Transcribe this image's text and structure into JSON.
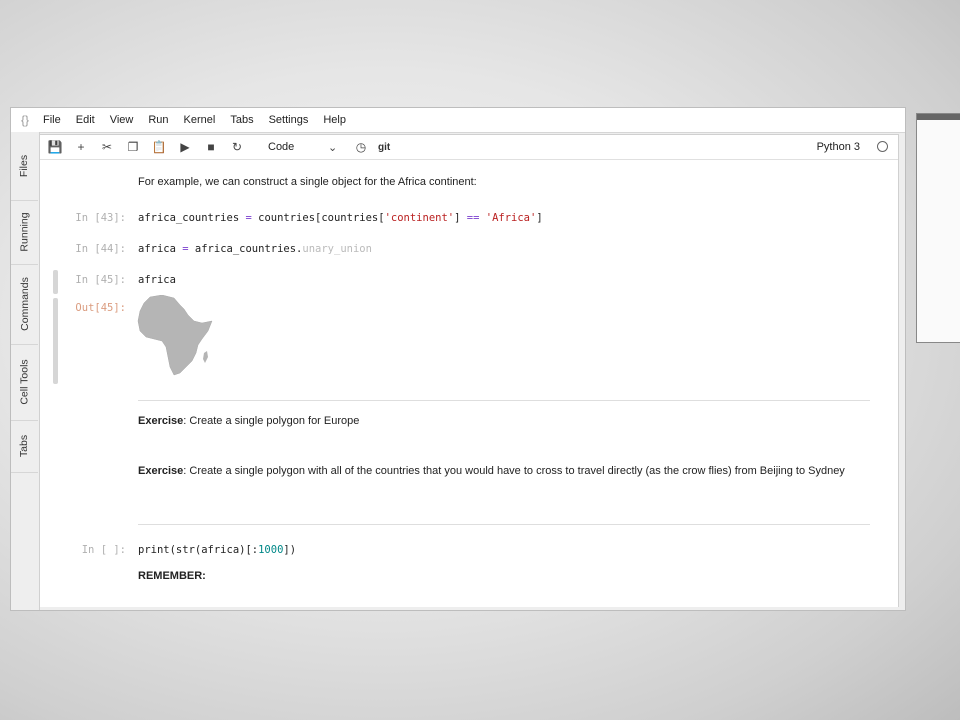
{
  "menu": {
    "logo": "{}",
    "items": [
      "File",
      "Edit",
      "View",
      "Run",
      "Kernel",
      "Tabs",
      "Settings",
      "Help"
    ]
  },
  "sidebar": {
    "tabs": [
      "Files",
      "Running",
      "Commands",
      "Cell Tools",
      "Tabs"
    ]
  },
  "toolbar": {
    "cell_type": "Code",
    "git_label": "git",
    "kernel_name": "Python 3"
  },
  "cells": {
    "intro_text": "For example, we can construct a single object for the Africa continent:",
    "c43": {
      "prompt": "In [43]:",
      "code_a": "africa_countries ",
      "code_b": "=",
      "code_c": " countries[countries[",
      "code_d": "'continent'",
      "code_e": "] ",
      "code_f": "==",
      "code_g": " ",
      "code_h": "'Africa'",
      "code_i": "]"
    },
    "c44": {
      "prompt": "In [44]:",
      "code_a": "africa ",
      "code_b": "=",
      "code_c": " africa_countries.",
      "code_d": "unary_union"
    },
    "c45": {
      "prompt": "In [45]:",
      "code": "africa",
      "out_prompt": "Out[45]:"
    },
    "exercise1": {
      "label": "Exercise",
      "text": ": Create a single polygon for Europe"
    },
    "exercise2": {
      "label": "Exercise",
      "text": ": Create a single polygon with all of the countries that you would have to cross to travel directly (as the crow flies) from Beijing to Sydney"
    },
    "c_empty": {
      "prompt": "In [ ]:",
      "code_a": "print(str(africa)[:",
      "code_b": "1000",
      "code_c": "])"
    },
    "remember": "REMEMBER:"
  },
  "colors": {
    "africa_fill": "#b5b5b5",
    "prompt": "#b0b0b0",
    "string": "#ba2121"
  }
}
